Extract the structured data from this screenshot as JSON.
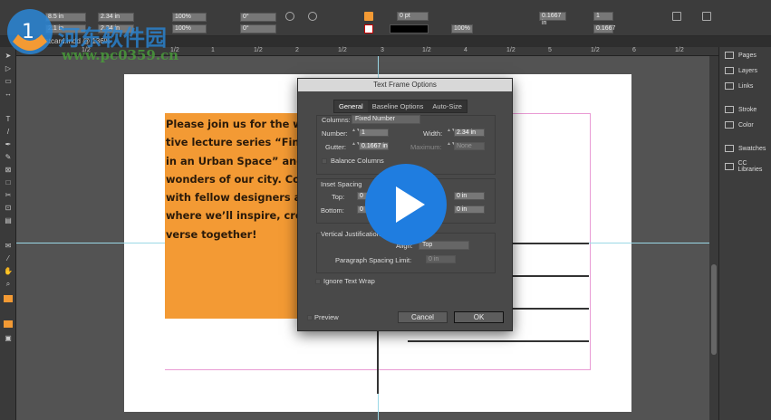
{
  "toolbar": {
    "x": "8.5 in",
    "y": "2.1 in",
    "w": "2.34 in",
    "h": "2.34 in",
    "scale_x": "100%",
    "scale_y": "100%",
    "rotate": "0°",
    "shear": "0°",
    "stroke_weight": "0 pt",
    "opacity": "100%",
    "gap": "0.1667 in",
    "columns": "1",
    "inset": "0.1667",
    "fill_color": "#f39a34"
  },
  "doc_tab": "Postcard.indd @ 136%",
  "ruler": [
    "1/2",
    "1/2",
    "1",
    "1/2",
    "2",
    "1/2",
    "3",
    "1/2",
    "4",
    "1/2",
    "5",
    "1/2",
    "6",
    "1/2"
  ],
  "panel": {
    "items": [
      "Pages",
      "Layers",
      "Links",
      "Stroke",
      "Color",
      "Swatches",
      "CC Libraries"
    ]
  },
  "frame_text": [
    "Please join us for the wee",
    "tive lecture series “Finding",
    "in an Urban Space” and dis",
    "wonders of our city. Come",
    "with fellow designers at A",
    "where we’ll inspire, create",
    "verse together!"
  ],
  "dialog": {
    "title": "Text Frame Options",
    "tabs": [
      "General",
      "Baseline Options",
      "Auto-Size"
    ],
    "columns_label": "Columns:",
    "columns_value": "Fixed Number",
    "number_label": "Number:",
    "number_value": "1",
    "width_label": "Width:",
    "width_value": "2.34 in",
    "gutter_label": "Gutter:",
    "gutter_value": "0.1667 in",
    "maximum_label": "Maximum:",
    "maximum_value": "None",
    "balance_columns": "Balance Columns",
    "inset_label": "Inset Spacing",
    "top_label": "Top:",
    "top_value": "0",
    "bottom_label": "Bottom:",
    "bottom_value": "0",
    "left_value": "0 in",
    "right_value": "0 in",
    "vj_label": "Vertical Justification",
    "align_label": "Align:",
    "align_value": "Top",
    "psl_label": "Paragraph Spacing Limit:",
    "psl_value": "0 in",
    "ignore_wrap": "Ignore Text Wrap",
    "preview": "Preview",
    "cancel": "Cancel",
    "ok": "OK"
  },
  "watermark": {
    "text": "河东软件园",
    "url": "www.pc0359.cn"
  }
}
